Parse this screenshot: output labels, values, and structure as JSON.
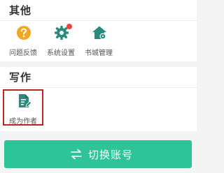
{
  "sections": [
    {
      "title": "其他",
      "items": [
        {
          "label": "问题反馈",
          "icon": "question-circle-icon"
        },
        {
          "label": "系统设置",
          "icon": "settings-gear-icon"
        },
        {
          "label": "书城管理",
          "icon": "bookstore-house-icon"
        }
      ]
    },
    {
      "title": "写作",
      "items": [
        {
          "label": "成为作者",
          "icon": "document-edit-icon"
        }
      ]
    }
  ],
  "switch_account": {
    "label": "切换账号",
    "icon": "switch-arrows-icon"
  },
  "colors": {
    "accent": "#2ec497",
    "question_icon": "#f2a623",
    "notification_dot": "#e8473f",
    "highlight_border": "#b3262a"
  }
}
